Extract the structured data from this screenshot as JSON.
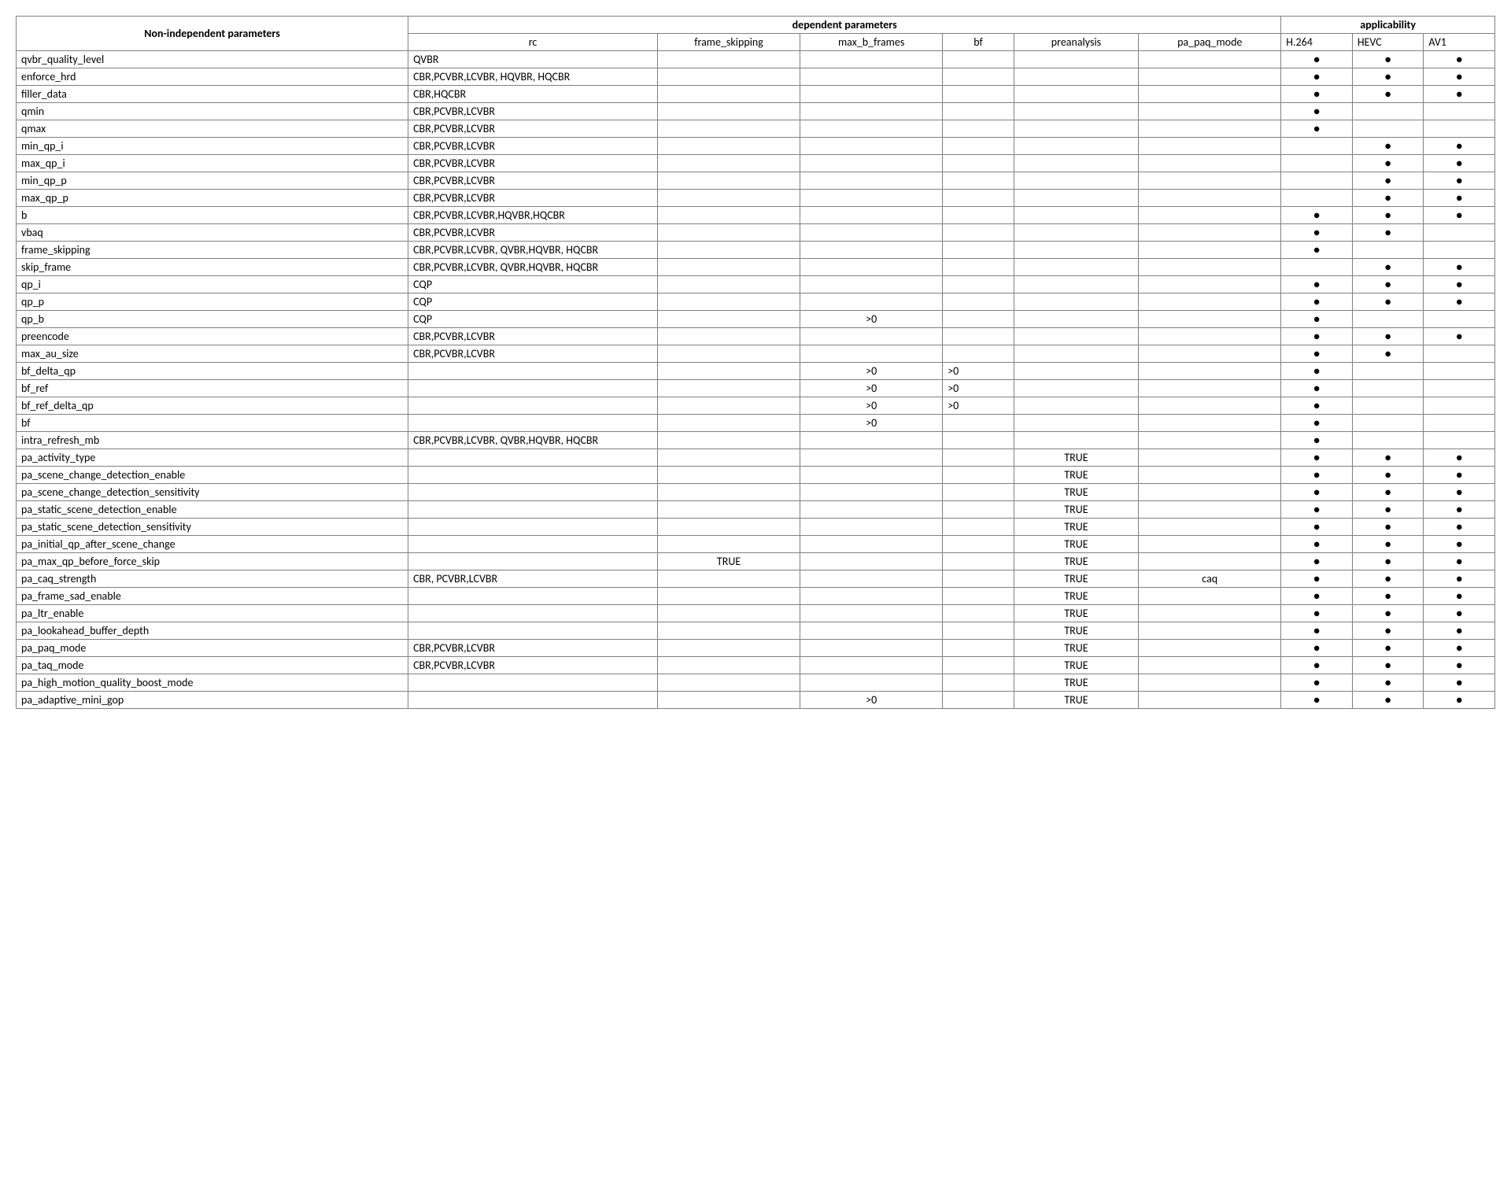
{
  "headers": {
    "nonind": "Non-independent parameters",
    "dependent": "dependent parameters",
    "applicability": "applicability",
    "rc": "rc",
    "frame_skipping": "frame_skipping",
    "max_b_frames": "max_b_frames",
    "bf": "bf",
    "preanalysis": "preanalysis",
    "pa_paq_mode": "pa_paq_mode",
    "h264": "H.264",
    "hevc": "HEVC",
    "av1": "AV1"
  },
  "dot": "●",
  "rows": [
    {
      "name": "qvbr_quality_level",
      "rc": "QVBR",
      "fs": "",
      "mbf": "",
      "bf": "",
      "pre": "",
      "paq": "",
      "h264": true,
      "hevc": true,
      "av1": true
    },
    {
      "name": "enforce_hrd",
      "rc": "CBR,PCVBR,LCVBR, HQVBR, HQCBR",
      "fs": "",
      "mbf": "",
      "bf": "",
      "pre": "",
      "paq": "",
      "h264": true,
      "hevc": true,
      "av1": true
    },
    {
      "name": "filler_data",
      "rc": "CBR,HQCBR",
      "fs": "",
      "mbf": "",
      "bf": "",
      "pre": "",
      "paq": "",
      "h264": true,
      "hevc": true,
      "av1": true
    },
    {
      "name": "qmin",
      "rc": "CBR,PCVBR,LCVBR",
      "fs": "",
      "mbf": "",
      "bf": "",
      "pre": "",
      "paq": "",
      "h264": true,
      "hevc": false,
      "av1": false
    },
    {
      "name": "qmax",
      "rc": "CBR,PCVBR,LCVBR",
      "fs": "",
      "mbf": "",
      "bf": "",
      "pre": "",
      "paq": "",
      "h264": true,
      "hevc": false,
      "av1": false
    },
    {
      "name": "min_qp_i",
      "rc": "CBR,PCVBR,LCVBR",
      "fs": "",
      "mbf": "",
      "bf": "",
      "pre": "",
      "paq": "",
      "h264": false,
      "hevc": true,
      "av1": true
    },
    {
      "name": "max_qp_i",
      "rc": "CBR,PCVBR,LCVBR",
      "fs": "",
      "mbf": "",
      "bf": "",
      "pre": "",
      "paq": "",
      "h264": false,
      "hevc": true,
      "av1": true
    },
    {
      "name": "min_qp_p",
      "rc": "CBR,PCVBR,LCVBR",
      "fs": "",
      "mbf": "",
      "bf": "",
      "pre": "",
      "paq": "",
      "h264": false,
      "hevc": true,
      "av1": true
    },
    {
      "name": "max_qp_p",
      "rc": "CBR,PCVBR,LCVBR",
      "fs": "",
      "mbf": "",
      "bf": "",
      "pre": "",
      "paq": "",
      "h264": false,
      "hevc": true,
      "av1": true
    },
    {
      "name": "b",
      "rc": "CBR,PCVBR,LCVBR,HQVBR,HQCBR",
      "fs": "",
      "mbf": "",
      "bf": "",
      "pre": "",
      "paq": "",
      "h264": true,
      "hevc": true,
      "av1": true
    },
    {
      "name": "vbaq",
      "rc": "CBR,PCVBR,LCVBR",
      "fs": "",
      "mbf": "",
      "bf": "",
      "pre": "",
      "paq": "",
      "h264": true,
      "hevc": true,
      "av1": false
    },
    {
      "name": "frame_skipping",
      "rc": "CBR,PCVBR,LCVBR, QVBR,HQVBR, HQCBR",
      "fs": "",
      "mbf": "",
      "bf": "",
      "pre": "",
      "paq": "",
      "h264": true,
      "hevc": false,
      "av1": false
    },
    {
      "name": "skip_frame",
      "rc": "CBR,PCVBR,LCVBR, QVBR,HQVBR, HQCBR",
      "fs": "",
      "mbf": "",
      "bf": "",
      "pre": "",
      "paq": "",
      "h264": false,
      "hevc": true,
      "av1": true
    },
    {
      "name": "qp_i",
      "rc": "CQP",
      "fs": "",
      "mbf": "",
      "bf": "",
      "pre": "",
      "paq": "",
      "h264": true,
      "hevc": true,
      "av1": true
    },
    {
      "name": "qp_p",
      "rc": "CQP",
      "fs": "",
      "mbf": "",
      "bf": "",
      "pre": "",
      "paq": "",
      "h264": true,
      "hevc": true,
      "av1": true
    },
    {
      "name": "qp_b",
      "rc": "CQP",
      "fs": "",
      "mbf": ">0",
      "bf": "",
      "pre": "",
      "paq": "",
      "h264": true,
      "hevc": false,
      "av1": false
    },
    {
      "name": "preencode",
      "rc": "CBR,PCVBR,LCVBR",
      "fs": "",
      "mbf": "",
      "bf": "",
      "pre": "",
      "paq": "",
      "h264": true,
      "hevc": true,
      "av1": true
    },
    {
      "name": "max_au_size",
      "rc": "CBR,PCVBR,LCVBR",
      "fs": "",
      "mbf": "",
      "bf": "",
      "pre": "",
      "paq": "",
      "h264": true,
      "hevc": true,
      "av1": false
    },
    {
      "name": "bf_delta_qp",
      "rc": "",
      "fs": "",
      "mbf": ">0",
      "bf": ">0",
      "pre": "",
      "paq": "",
      "h264": true,
      "hevc": false,
      "av1": false
    },
    {
      "name": "bf_ref",
      "rc": "",
      "fs": "",
      "mbf": ">0",
      "bf": ">0",
      "pre": "",
      "paq": "",
      "h264": true,
      "hevc": false,
      "av1": false
    },
    {
      "name": "bf_ref_delta_qp",
      "rc": "",
      "fs": "",
      "mbf": ">0",
      "bf": ">0",
      "pre": "",
      "paq": "",
      "h264": true,
      "hevc": false,
      "av1": false
    },
    {
      "name": "bf",
      "rc": "",
      "fs": "",
      "mbf": ">0",
      "bf": "",
      "pre": "",
      "paq": "",
      "h264": true,
      "hevc": false,
      "av1": false
    },
    {
      "name": "intra_refresh_mb",
      "rc": "CBR,PCVBR,LCVBR, QVBR,HQVBR, HQCBR",
      "fs": "",
      "mbf": "",
      "bf": "",
      "pre": "",
      "paq": "",
      "h264": true,
      "hevc": false,
      "av1": false
    },
    {
      "name": "pa_activity_type",
      "rc": "",
      "fs": "",
      "mbf": "",
      "bf": "",
      "pre": "TRUE",
      "paq": "",
      "h264": true,
      "hevc": true,
      "av1": true
    },
    {
      "name": "pa_scene_change_detection_enable",
      "rc": "",
      "fs": "",
      "mbf": "",
      "bf": "",
      "pre": "TRUE",
      "paq": "",
      "h264": true,
      "hevc": true,
      "av1": true
    },
    {
      "name": "pa_scene_change_detection_sensitivity",
      "rc": "",
      "fs": "",
      "mbf": "",
      "bf": "",
      "pre": "TRUE",
      "paq": "",
      "h264": true,
      "hevc": true,
      "av1": true
    },
    {
      "name": "pa_static_scene_detection_enable",
      "rc": "",
      "fs": "",
      "mbf": "",
      "bf": "",
      "pre": "TRUE",
      "paq": "",
      "h264": true,
      "hevc": true,
      "av1": true
    },
    {
      "name": "pa_static_scene_detection_sensitivity",
      "rc": "",
      "fs": "",
      "mbf": "",
      "bf": "",
      "pre": "TRUE",
      "paq": "",
      "h264": true,
      "hevc": true,
      "av1": true
    },
    {
      "name": "pa_initial_qp_after_scene_change",
      "rc": "",
      "fs": "",
      "mbf": "",
      "bf": "",
      "pre": "TRUE",
      "paq": "",
      "h264": true,
      "hevc": true,
      "av1": true
    },
    {
      "name": "pa_max_qp_before_force_skip",
      "rc": "",
      "fs": "TRUE",
      "mbf": "",
      "bf": "",
      "pre": "TRUE",
      "paq": "",
      "h264": true,
      "hevc": true,
      "av1": true
    },
    {
      "name": "pa_caq_strength",
      "rc": "CBR, PCVBR,LCVBR",
      "fs": "",
      "mbf": "",
      "bf": "",
      "pre": "TRUE",
      "paq": "caq",
      "h264": true,
      "hevc": true,
      "av1": true
    },
    {
      "name": "pa_frame_sad_enable",
      "rc": "",
      "fs": "",
      "mbf": "",
      "bf": "",
      "pre": "TRUE",
      "paq": "",
      "h264": true,
      "hevc": true,
      "av1": true
    },
    {
      "name": "pa_ltr_enable",
      "rc": "",
      "fs": "",
      "mbf": "",
      "bf": "",
      "pre": "TRUE",
      "paq": "",
      "h264": true,
      "hevc": true,
      "av1": true
    },
    {
      "name": "pa_lookahead_buffer_depth",
      "rc": "",
      "fs": "",
      "mbf": "",
      "bf": "",
      "pre": "TRUE",
      "paq": "",
      "h264": true,
      "hevc": true,
      "av1": true
    },
    {
      "name": "pa_paq_mode",
      "rc": "CBR,PCVBR,LCVBR",
      "fs": "",
      "mbf": "",
      "bf": "",
      "pre": "TRUE",
      "paq": "",
      "h264": true,
      "hevc": true,
      "av1": true
    },
    {
      "name": "pa_taq_mode",
      "rc": "CBR,PCVBR,LCVBR",
      "fs": "",
      "mbf": "",
      "bf": "",
      "pre": "TRUE",
      "paq": "",
      "h264": true,
      "hevc": true,
      "av1": true
    },
    {
      "name": "pa_high_motion_quality_boost_mode",
      "rc": "",
      "fs": "",
      "mbf": "",
      "bf": "",
      "pre": "TRUE",
      "paq": "",
      "h264": true,
      "hevc": true,
      "av1": true
    },
    {
      "name": "pa_adaptive_mini_gop",
      "rc": "",
      "fs": "",
      "mbf": ">0",
      "bf": "",
      "pre": "TRUE",
      "paq": "",
      "h264": true,
      "hevc": true,
      "av1": true
    }
  ]
}
